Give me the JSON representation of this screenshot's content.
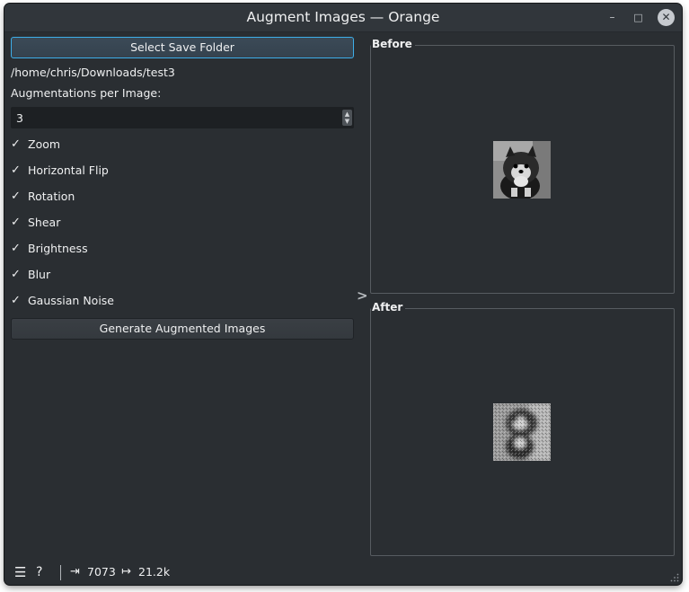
{
  "window": {
    "title": "Augment Images — Orange",
    "controls": {
      "minimize": "–",
      "maximize": "□",
      "close": "✕"
    }
  },
  "left": {
    "save_button_label": "Select Save Folder",
    "save_path": "/home/chris/Downloads/test3",
    "augmentations_label": "Augmentations per Image:",
    "augmentations_value": "3",
    "options": [
      {
        "label": "Zoom",
        "checked": true
      },
      {
        "label": "Horizontal Flip",
        "checked": true
      },
      {
        "label": "Rotation",
        "checked": true
      },
      {
        "label": "Shear",
        "checked": true
      },
      {
        "label": "Brightness",
        "checked": true
      },
      {
        "label": "Blur",
        "checked": true
      },
      {
        "label": "Gaussian Noise",
        "checked": true
      }
    ],
    "check_glyph": "✓",
    "generate_button_label": "Generate Augmented Images"
  },
  "right": {
    "before_title": "Before",
    "after_title": "After"
  },
  "status": {
    "input_count": "7073",
    "output_count": "21.2k"
  },
  "colors": {
    "window_bg": "#2a2e32",
    "accent": "#3daee9",
    "text": "#eff0f1"
  }
}
